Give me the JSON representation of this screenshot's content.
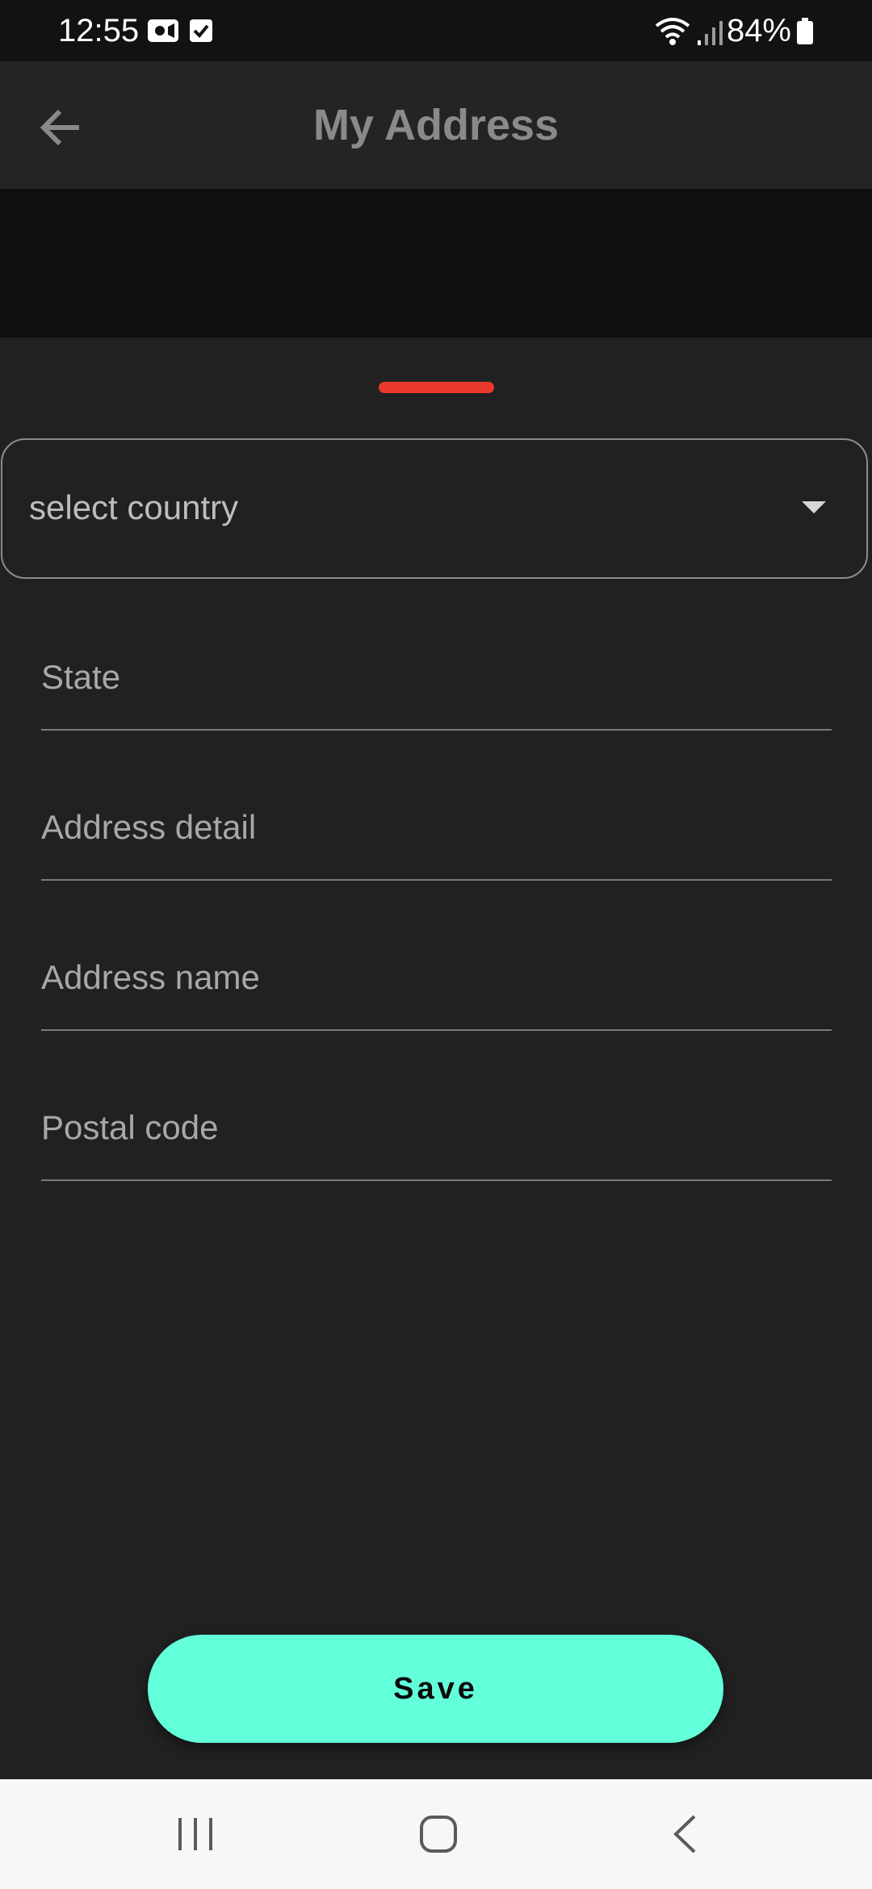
{
  "status_bar": {
    "time": "12:55",
    "battery": "84%",
    "icons": [
      "video-camera-icon",
      "checkbox-icon",
      "wifi-icon",
      "signal-icon",
      "battery-icon"
    ]
  },
  "app_bar": {
    "title": "My Address",
    "back_icon": "arrow-left-icon"
  },
  "form": {
    "country_select": {
      "label": "select country",
      "icon": "dropdown-arrow-icon"
    },
    "state": {
      "placeholder": "State",
      "value": ""
    },
    "address_detail": {
      "placeholder": "Address detail",
      "value": ""
    },
    "address_name": {
      "placeholder": "Address name",
      "value": ""
    },
    "postal_code": {
      "placeholder": "Postal code",
      "value": ""
    }
  },
  "actions": {
    "save_label": "Save"
  },
  "nav_bar": {
    "items": [
      "recent-apps-icon",
      "home-icon",
      "back-icon"
    ]
  },
  "colors": {
    "accent_button": "#63ffdb",
    "drag_handle": "#e8392c",
    "background": "#212121",
    "app_bar": "#242424"
  }
}
